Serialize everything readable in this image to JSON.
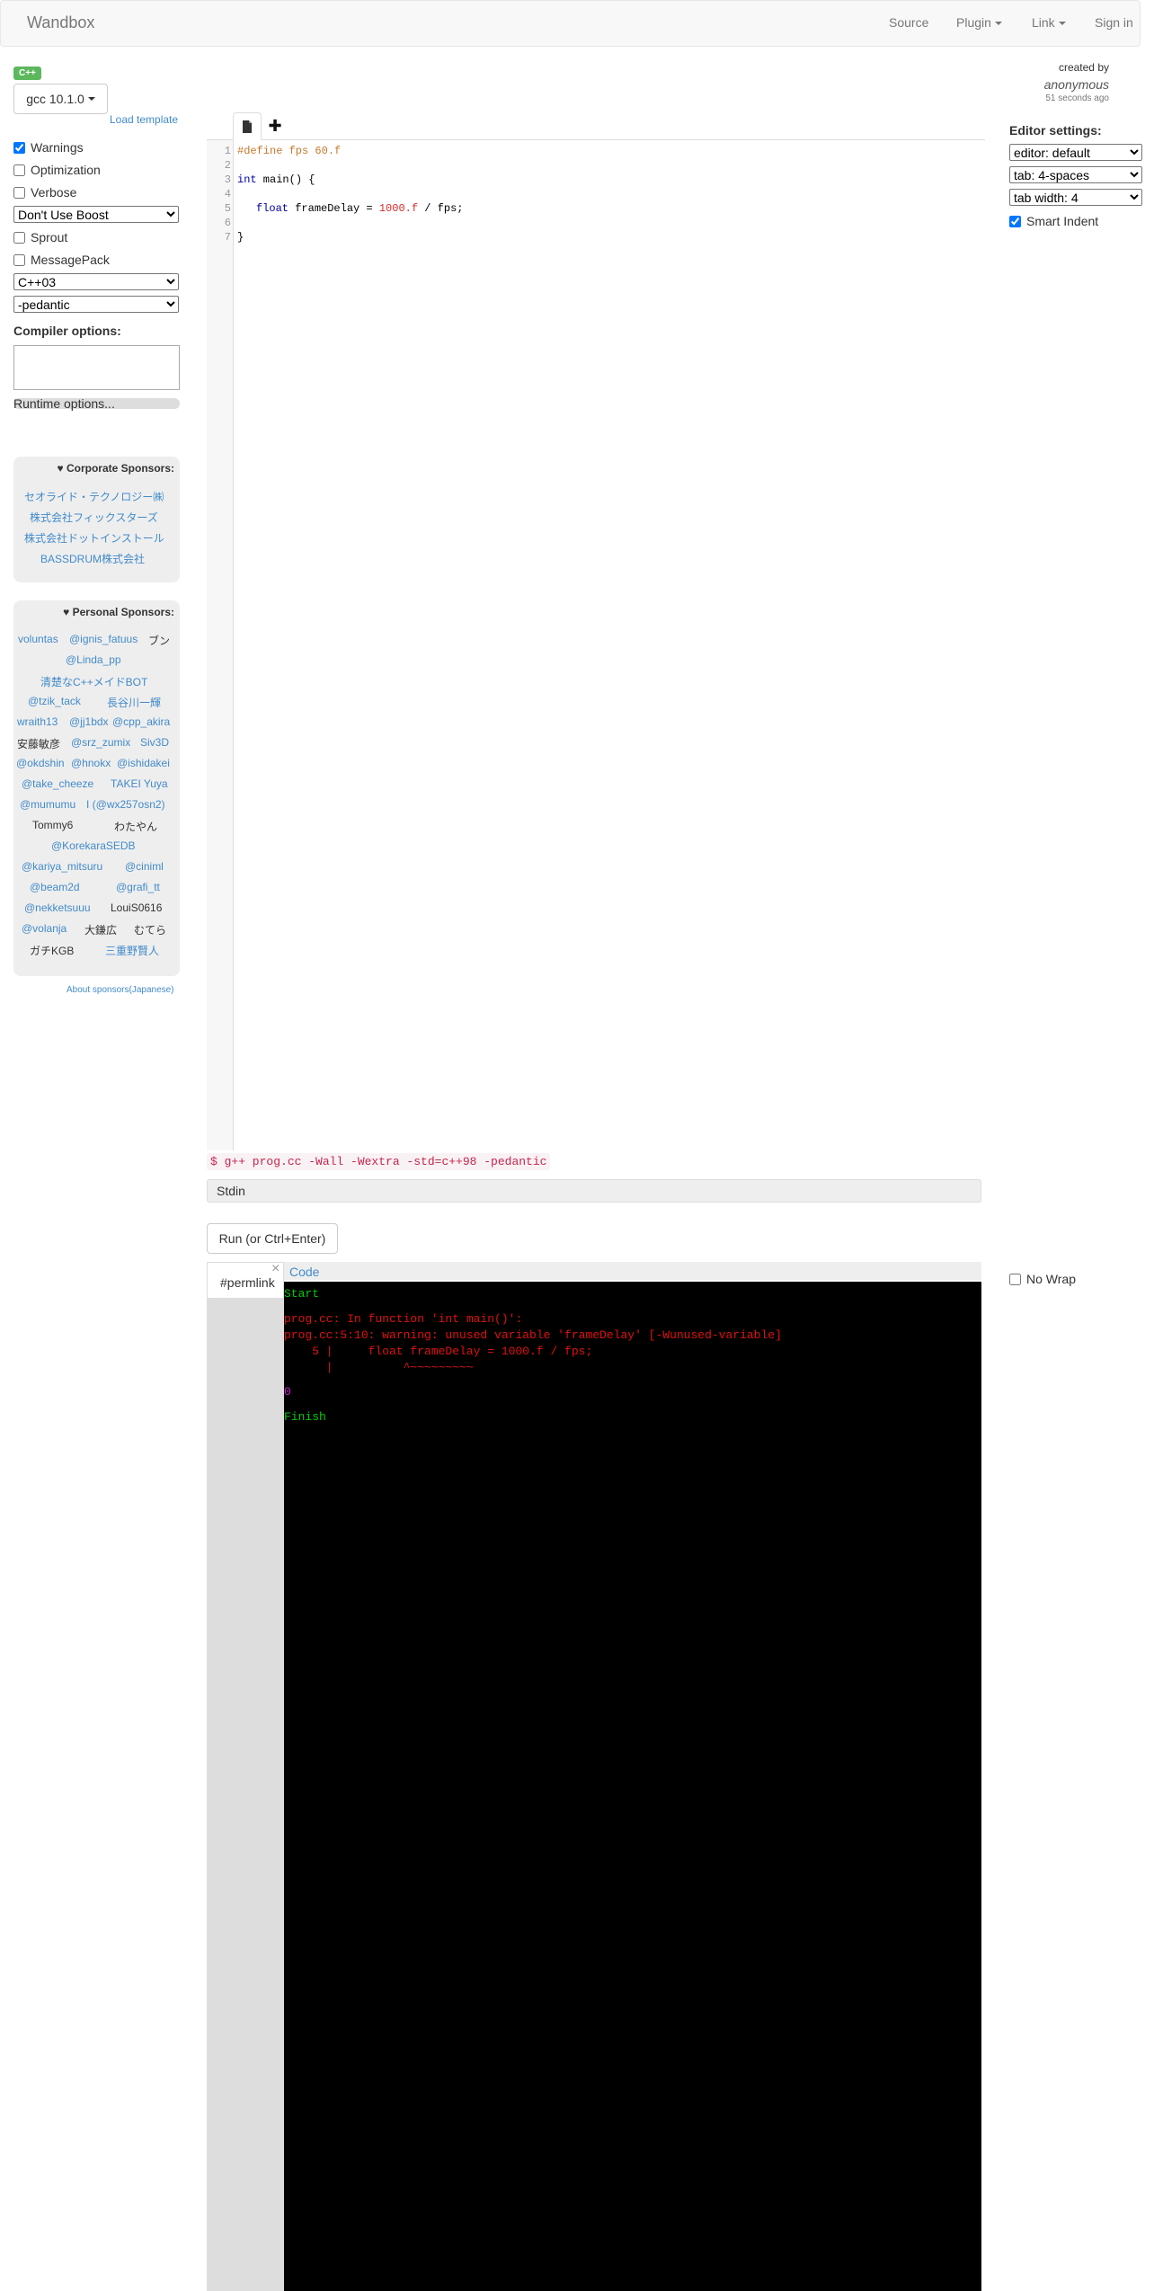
{
  "navbar": {
    "brand": "Wandbox",
    "source": "Source",
    "plugin": "Plugin",
    "link": "Link",
    "sign_in": "Sign in"
  },
  "compiler": {
    "language_badge": "C++",
    "selected": "gcc 10.1.0",
    "load_template": "Load template"
  },
  "options": {
    "warnings": {
      "label": "Warnings",
      "checked": true
    },
    "optimization": {
      "label": "Optimization",
      "checked": false
    },
    "verbose": {
      "label": "Verbose",
      "checked": false
    },
    "boost": "Don't Use Boost",
    "sprout": {
      "label": "Sprout",
      "checked": false
    },
    "msgpack": {
      "label": "MessagePack",
      "checked": false
    },
    "std": "C++03",
    "pedantic": "-pedantic",
    "compiler_options_label": "Compiler options:",
    "runtime_options": "Runtime options..."
  },
  "corporate_sponsors": {
    "title": " Corporate Sponsors:",
    "names": [
      "セオライド・テクノロジー㈱",
      "株式会社フィックスターズ",
      "株式会社ドットインストール",
      "BASSDRUM株式会社"
    ]
  },
  "personal_sponsors": {
    "title": " Personal Sponsors:",
    "names": [
      "voluntas",
      "@ignis_fatuus",
      "ブン",
      "@Linda_pp",
      "清楚なC++メイドBOT",
      "@tzik_tack",
      "長谷川一輝",
      "wraith13",
      "@jj1bdx",
      "@cpp_akira",
      "安藤敏彦",
      "@srz_zumix",
      "Siv3D",
      "@okdshin",
      "@hnokx",
      "@ishidakei",
      "@take_cheeze",
      "TAKEI Yuya",
      "@mumumu",
      "I (@wx257osn2)",
      "Tommy6",
      "わたやん",
      "@KorekaraSEDB",
      "@kariya_mitsuru",
      "@ciniml",
      "@beam2d",
      "@grafi_tt",
      "@nekketsuuu",
      "LouiS0616",
      "@volanja",
      "大鎌広",
      "むてら",
      "ガチKGB",
      "三重野賢人"
    ]
  },
  "about_sponsors": "About sponsors(Japanese)",
  "editor": {
    "line_numbers": [
      "1",
      "2",
      "3",
      "4",
      "5",
      "6",
      "7"
    ],
    "code": {
      "l1": "#define fps 60.f",
      "l3_kw": "int",
      "l3_rest": " main() {",
      "l5_kw": "float",
      "l5_mid": " frameDelay = ",
      "l5_num": "1000.f",
      "l5_end": " / fps;",
      "l7": "}"
    }
  },
  "meta": {
    "created_by": "created by",
    "author": "anonymous",
    "time_ago": "51 seconds ago"
  },
  "editor_settings": {
    "label": "Editor settings:",
    "editor": "editor: default",
    "tab": "tab: 4-spaces",
    "tab_width": "tab width: 4",
    "smart_indent": {
      "label": "Smart Indent",
      "checked": true
    }
  },
  "command": "$ g++ prog.cc -Wall -Wextra -std=c++98 -pedantic",
  "stdin_label": "Stdin",
  "run_button": "Run (or Ctrl+Enter)",
  "output": {
    "permlink_tab": "#permlink",
    "close": "×",
    "code_tab": "Code",
    "no_wrap": "No Wrap",
    "lines": {
      "start": "Start",
      "err1": "prog.cc: In function 'int main()':",
      "err2": "prog.cc:5:10: warning: unused variable 'frameDelay' [-Wunused-variable]",
      "err3": "    5 |     float frameDelay = 1000.f / fps;",
      "err4": "      |          ^~~~~~~~~~",
      "exit": "0",
      "finish": "Finish"
    }
  },
  "colors": {
    "accent": "#428bca",
    "badge": "#5cb85c",
    "terminal_bg": "#000000",
    "ok_green": "#00cc00",
    "error_red": "#e01010"
  }
}
